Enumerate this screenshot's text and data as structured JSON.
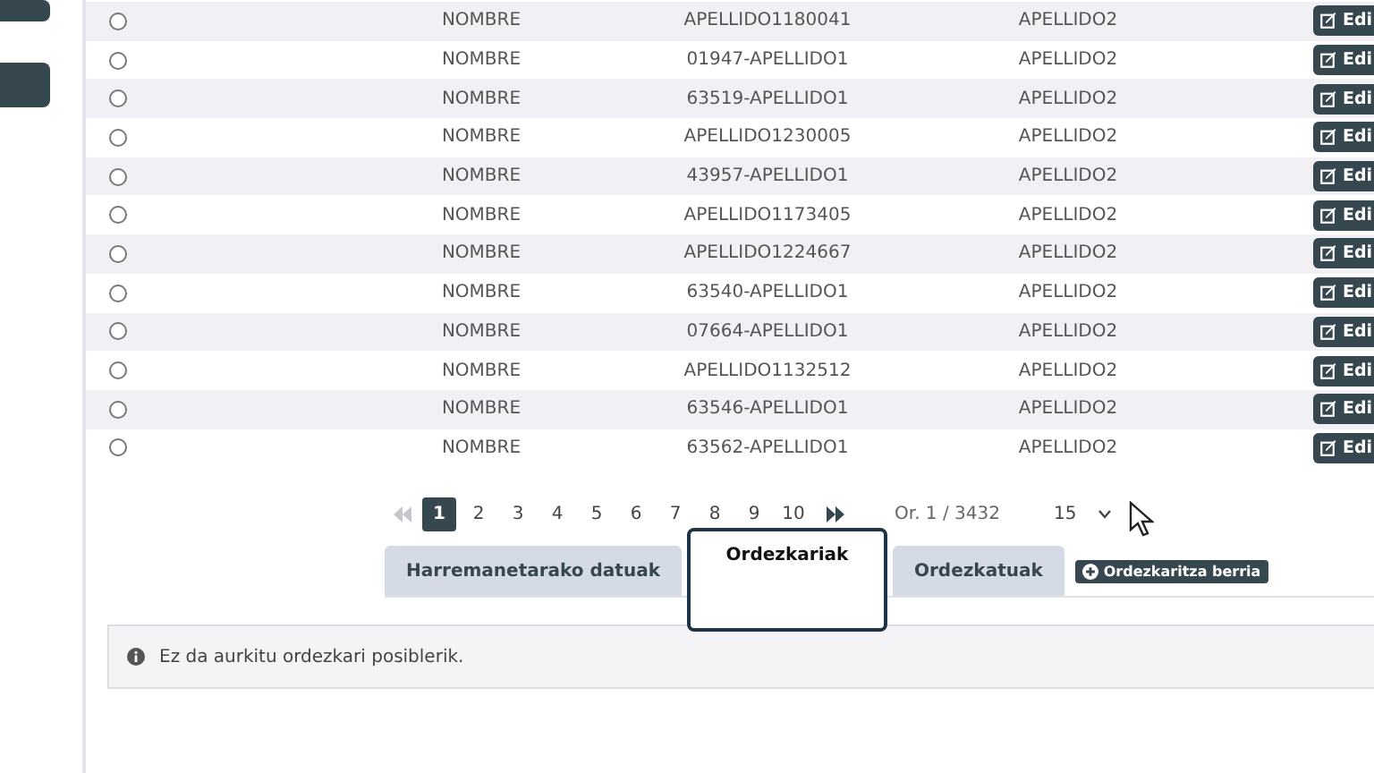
{
  "table": {
    "rows": [
      {
        "selected": false,
        "name": "NOMBRE",
        "surname1": "APELLIDO1180041",
        "surname2": "APELLIDO2",
        "action": "Edi"
      },
      {
        "selected": false,
        "name": "NOMBRE",
        "surname1": "01947-APELLIDO1",
        "surname2": "APELLIDO2",
        "action": "Edi"
      },
      {
        "selected": false,
        "name": "NOMBRE",
        "surname1": "63519-APELLIDO1",
        "surname2": "APELLIDO2",
        "action": "Edi"
      },
      {
        "selected": false,
        "name": "NOMBRE",
        "surname1": "APELLIDO1230005",
        "surname2": "APELLIDO2",
        "action": "Edi"
      },
      {
        "selected": false,
        "name": "NOMBRE",
        "surname1": "43957-APELLIDO1",
        "surname2": "APELLIDO2",
        "action": "Edi"
      },
      {
        "selected": false,
        "name": "NOMBRE",
        "surname1": "APELLIDO1173405",
        "surname2": "APELLIDO2",
        "action": "Edi"
      },
      {
        "selected": false,
        "name": "NOMBRE",
        "surname1": "APELLIDO1224667",
        "surname2": "APELLIDO2",
        "action": "Edi"
      },
      {
        "selected": false,
        "name": "NOMBRE",
        "surname1": "63540-APELLIDO1",
        "surname2": "APELLIDO2",
        "action": "Edi"
      },
      {
        "selected": false,
        "name": "NOMBRE",
        "surname1": "07664-APELLIDO1",
        "surname2": "APELLIDO2",
        "action": "Edi"
      },
      {
        "selected": false,
        "name": "NOMBRE",
        "surname1": "APELLIDO1132512",
        "surname2": "APELLIDO2",
        "action": "Edi"
      },
      {
        "selected": false,
        "name": "NOMBRE",
        "surname1": "63546-APELLIDO1",
        "surname2": "APELLIDO2",
        "action": "Edi"
      },
      {
        "selected": false,
        "name": "NOMBRE",
        "surname1": "63562-APELLIDO1",
        "surname2": "APELLIDO2",
        "action": "Edi"
      }
    ]
  },
  "pagination": {
    "first_disabled": true,
    "pages": [
      {
        "label": "1",
        "selected": true
      },
      {
        "label": "2",
        "selected": false
      },
      {
        "label": "3",
        "selected": false
      },
      {
        "label": "4",
        "selected": false
      },
      {
        "label": "5",
        "selected": false
      },
      {
        "label": "6",
        "selected": false
      },
      {
        "label": "7",
        "selected": false
      },
      {
        "label": "8",
        "selected": false
      },
      {
        "label": "9",
        "selected": false
      },
      {
        "label": "10",
        "selected": false
      }
    ],
    "last_disabled": false,
    "page_info": "Or. 1 / 3432",
    "page_size": "15"
  },
  "tabs": [
    {
      "label": "Harremanetarako datuak",
      "selected": false
    },
    {
      "label": "Ordezkariak",
      "selected": true
    },
    {
      "label": "Ordezkatuak",
      "selected": false
    }
  ],
  "new_button": "Ordezkaritza berria",
  "alert": "Ez da aurkitu ordezkari posiblerik."
}
